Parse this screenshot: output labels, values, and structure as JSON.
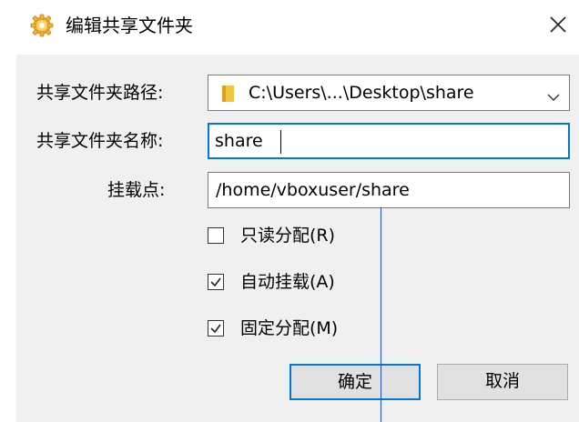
{
  "window": {
    "title": "编辑共享文件夹",
    "app_icon": "gear-icon",
    "close_icon": "close-icon"
  },
  "form": {
    "path_label": "共享文件夹路径:",
    "path_value": "C:\\Users\\...\\Desktop\\share",
    "path_icon": "folder-icon",
    "name_label": "共享文件夹名称:",
    "name_value": "share",
    "mount_label": "挂载点:",
    "mount_value": "/home/vboxuser/share"
  },
  "options": [
    {
      "label": "只读分配(R)",
      "checked": false
    },
    {
      "label": "自动挂载(A)",
      "checked": true
    },
    {
      "label": "固定分配(M)",
      "checked": true
    }
  ],
  "buttons": {
    "ok": "确定",
    "cancel": "取消"
  },
  "colors": {
    "accent": "#0078d7",
    "panel_bg": "#f0f0f0",
    "button_bg": "#e1e1e1"
  }
}
